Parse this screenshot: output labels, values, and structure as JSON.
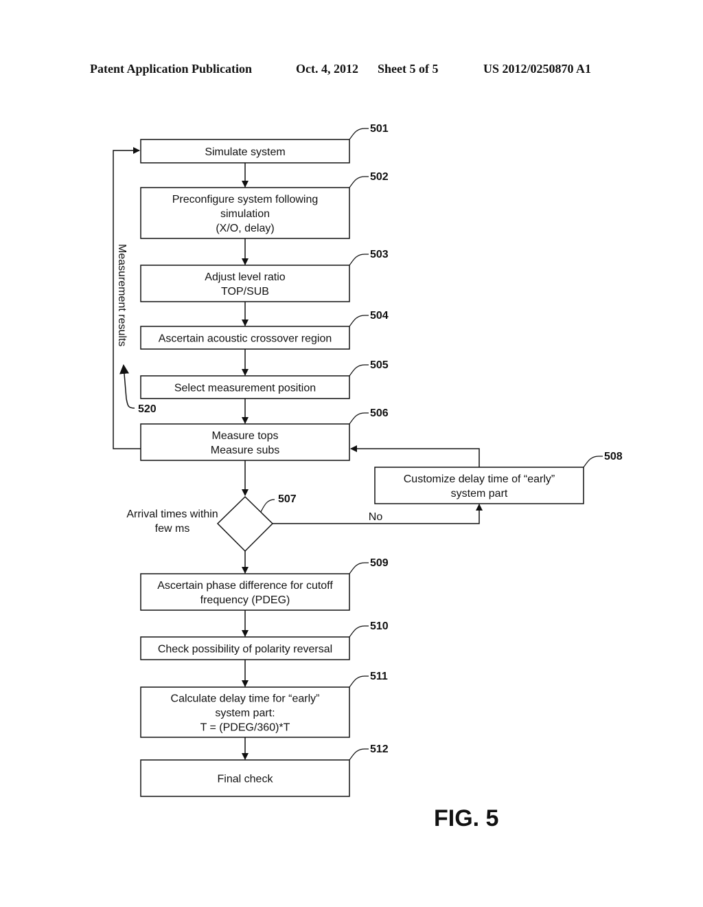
{
  "header": {
    "publication": "Patent Application Publication",
    "date": "Oct. 4, 2012",
    "sheet": "Sheet 5 of 5",
    "number": "US 2012/0250870 A1"
  },
  "figure_label": "FIG. 5",
  "steps": [
    {
      "ref": "501",
      "lines": [
        "Simulate system"
      ]
    },
    {
      "ref": "502",
      "lines": [
        "Preconfigure system following",
        "simulation",
        "(X/O, delay)"
      ]
    },
    {
      "ref": "503",
      "lines": [
        "Adjust level ratio",
        "TOP/SUB"
      ]
    },
    {
      "ref": "504",
      "lines": [
        "Ascertain acoustic crossover region"
      ]
    },
    {
      "ref": "505",
      "lines": [
        "Select measurement position"
      ]
    },
    {
      "ref": "506",
      "lines": [
        "Measure tops",
        "Measure subs"
      ]
    },
    {
      "ref": "509",
      "lines": [
        "Ascertain phase difference for cutoff",
        "frequency (PDEG)"
      ]
    },
    {
      "ref": "510",
      "lines": [
        "Check possibility of polarity reversal"
      ]
    },
    {
      "ref": "511",
      "lines": [
        "Calculate delay time for “early”",
        "system part:",
        "T = (PDEG/360)*T"
      ]
    },
    {
      "ref": "512",
      "lines": [
        "Final check"
      ]
    }
  ],
  "side_box": {
    "ref": "508",
    "lines": [
      "Customize delay time of “early”",
      "system part"
    ]
  },
  "decision": {
    "ref": "507",
    "lines": [
      "Arrival times within",
      "few ms"
    ],
    "no_label": "No"
  },
  "feedback": {
    "ref": "520",
    "label": "Measurement results"
  }
}
